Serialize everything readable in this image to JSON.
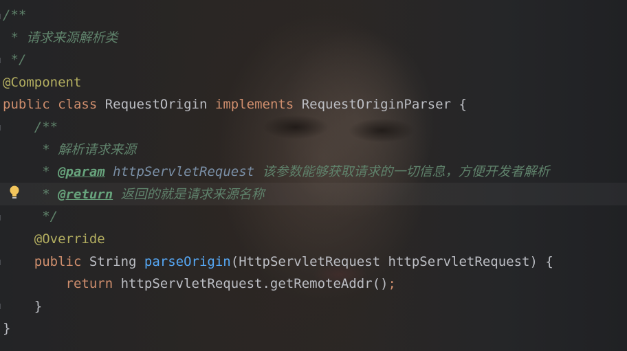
{
  "editor": {
    "lines": [
      {
        "indent": "",
        "parts": [
          {
            "t": "/**",
            "c": "doc"
          }
        ]
      },
      {
        "indent": "",
        "parts": [
          {
            "t": " * ",
            "c": "doc"
          },
          {
            "t": "请求来源解析类",
            "c": "doc-cn"
          }
        ]
      },
      {
        "indent": "",
        "parts": [
          {
            "t": " */",
            "c": "doc"
          }
        ]
      },
      {
        "indent": "",
        "parts": [
          {
            "t": "@Component",
            "c": "annot"
          }
        ]
      },
      {
        "indent": "",
        "parts": [
          {
            "t": "public ",
            "c": "kw"
          },
          {
            "t": "class ",
            "c": "kw"
          },
          {
            "t": "RequestOrigin ",
            "c": "ident"
          },
          {
            "t": "implements ",
            "c": "kw"
          },
          {
            "t": "RequestOriginParser {",
            "c": "ident"
          }
        ]
      },
      {
        "indent": "    ",
        "parts": [
          {
            "t": "/**",
            "c": "doc"
          }
        ]
      },
      {
        "indent": "    ",
        "parts": [
          {
            "t": " * ",
            "c": "doc"
          },
          {
            "t": "解析请求来源",
            "c": "doc-cn"
          }
        ]
      },
      {
        "indent": "    ",
        "parts": [
          {
            "t": " * ",
            "c": "doc"
          },
          {
            "t": "@param",
            "c": "tag"
          },
          {
            "t": " httpServletRequest ",
            "c": "param-name"
          },
          {
            "t": "该参数能够获取请求的一切信息，方便开发者解析",
            "c": "doc-cn"
          }
        ]
      },
      {
        "indent": "    ",
        "parts": [
          {
            "t": " * ",
            "c": "doc"
          },
          {
            "t": "@return",
            "c": "tag"
          },
          {
            "t": " ",
            "c": "doc"
          },
          {
            "t": "返回的就是请求来源名称",
            "c": "doc-cn"
          }
        ]
      },
      {
        "indent": "    ",
        "parts": [
          {
            "t": " */",
            "c": "doc"
          }
        ]
      },
      {
        "indent": "    ",
        "parts": [
          {
            "t": "@Override",
            "c": "annot"
          }
        ]
      },
      {
        "indent": "    ",
        "parts": [
          {
            "t": "public ",
            "c": "kw"
          },
          {
            "t": "String ",
            "c": "ident"
          },
          {
            "t": "parseOrigin",
            "c": "method"
          },
          {
            "t": "(HttpServletRequest httpServletRequest) {",
            "c": "ident"
          }
        ]
      },
      {
        "indent": "        ",
        "parts": [
          {
            "t": "return ",
            "c": "kw"
          },
          {
            "t": "httpServletRequest.getRemoteAddr()",
            "c": "method-call"
          },
          {
            "t": ";",
            "c": "semi"
          }
        ]
      },
      {
        "indent": "    ",
        "parts": [
          {
            "t": "}",
            "c": "punct"
          }
        ]
      },
      {
        "indent": "",
        "parts": [
          {
            "t": "}",
            "c": "punct"
          }
        ]
      }
    ],
    "gutter_icon": "lightbulb-icon",
    "colors": {
      "background": "#1e1f22",
      "keyword": "#cf8e6d",
      "annotation": "#b3ae60",
      "doc_comment": "#5f826b",
      "method_declaration": "#56a8f5",
      "identifier": "#bcbec4",
      "bulb": "#f2c55c"
    }
  }
}
